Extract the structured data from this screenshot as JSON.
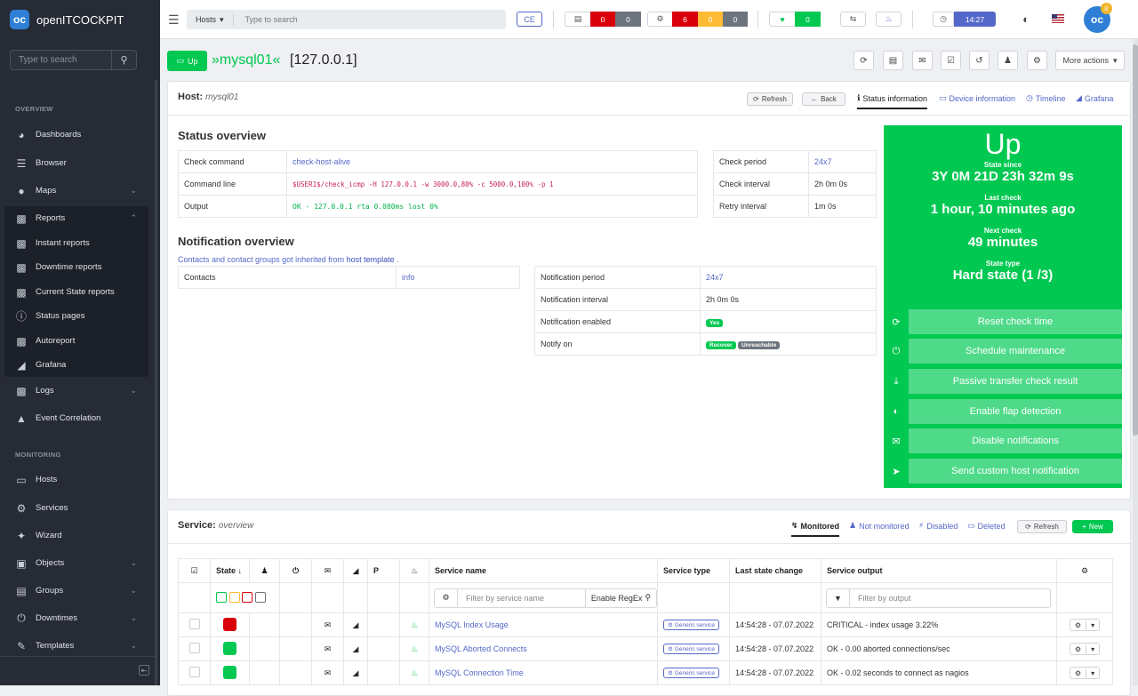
{
  "brand": {
    "name": "openITCOCKPIT",
    "logo_text": "oc"
  },
  "sidebar": {
    "search_placeholder": "Type to search",
    "sections": {
      "overview": "OVERVIEW",
      "monitoring": "MONITORING"
    },
    "items": [
      {
        "label": "Dashboards",
        "icon": "dashboard-icon"
      },
      {
        "label": "Browser",
        "icon": "list-icon"
      },
      {
        "label": "Maps",
        "icon": "map-marker-icon"
      },
      {
        "label": "Reports",
        "icon": "file-icon"
      },
      {
        "label": "Instant reports",
        "icon": "file-icon"
      },
      {
        "label": "Downtime reports",
        "icon": "file-icon"
      },
      {
        "label": "Current State reports",
        "icon": "file-icon"
      },
      {
        "label": "Status pages",
        "icon": "info-icon"
      },
      {
        "label": "Autoreport",
        "icon": "file-icon"
      },
      {
        "label": "Grafana",
        "icon": "chart-area-icon"
      },
      {
        "label": "Logs",
        "icon": "file-icon"
      },
      {
        "label": "Event Correlation",
        "icon": "sitemap-icon"
      },
      {
        "label": "Hosts",
        "icon": "desktop-icon"
      },
      {
        "label": "Services",
        "icon": "cogs-icon"
      },
      {
        "label": "Wizard",
        "icon": "magic-icon"
      },
      {
        "label": "Objects",
        "icon": "cubes-icon"
      },
      {
        "label": "Groups",
        "icon": "object-group-icon"
      },
      {
        "label": "Downtimes",
        "icon": "power-icon"
      },
      {
        "label": "Templates",
        "icon": "edit-icon"
      }
    ]
  },
  "topbar": {
    "search_select": "Hosts",
    "search_placeholder": "Type to search",
    "edition": "CE",
    "hosts_counts": [
      "0",
      "0"
    ],
    "service_counts": [
      "6",
      "0",
      "0"
    ],
    "heart_count": "0",
    "time": "14:27"
  },
  "host": {
    "state_button": "Up",
    "name": "»mysql01«",
    "ip": "[127.0.0.1]",
    "more_actions": "More actions"
  },
  "host_panel": {
    "title": "Host:",
    "subtitle": "mysql01",
    "refresh": "Refresh",
    "back": "Back",
    "tabs": [
      "Status information",
      "Device information",
      "Timeline",
      "Grafana"
    ],
    "status_overview": "Status overview",
    "check_command_label": "Check command",
    "check_command": "check-host-alive",
    "command_line_label": "Command line",
    "command_line": "$USER1$/check_icmp -H 127.0.0.1 -w 3000.0,80% -c 5000.0,100% -p 1",
    "output_label": "Output",
    "output": "OK - 127.0.0.1 rta 0.080ms lost 0%",
    "check_period_label": "Check period",
    "check_period": "24x7",
    "check_interval_label": "Check interval",
    "check_interval": "2h 0m 0s",
    "retry_interval_label": "Retry interval",
    "retry_interval": "1m 0s",
    "notification_overview": "Notification overview",
    "inherit_text": "Contacts and contact groups got inherited from",
    "inherit_link": "host template",
    "contacts_label": "Contacts",
    "contacts": "info",
    "notification_period_label": "Notification period",
    "notification_period": "24x7",
    "notification_interval_label": "Notification interval",
    "notification_interval": "2h 0m 0s",
    "notification_enabled_label": "Notification enabled",
    "notification_enabled": "Yes",
    "notify_on_label": "Notify on",
    "notify_recover": "Recover",
    "notify_unreachable": "Unreachable"
  },
  "state_box": {
    "state": "Up",
    "since_label": "State since",
    "since": "3Y 0M 21D 23h 32m 9s",
    "last_check_label": "Last check",
    "last_check": "1 hour, 10 minutes ago",
    "next_check_label": "Next check",
    "next_check": "49 minutes",
    "state_type_label": "State type",
    "state_type": "Hard state (1 /3)",
    "actions": [
      "Reset check time",
      "Schedule maintenance",
      "Passive transfer check result",
      "Enable flap detection",
      "Disable notifications",
      "Send custom host notification"
    ],
    "color": "#00c851"
  },
  "service_panel": {
    "title": "Service:",
    "subtitle": "overview",
    "tabs": [
      "Monitored",
      "Not monitored",
      "Disabled",
      "Deleted"
    ],
    "refresh": "Refresh",
    "new": "New",
    "headers": {
      "state": "State",
      "name": "Service name",
      "type": "Service type",
      "last_change": "Last state change",
      "output": "Service output",
      "p": "P"
    },
    "filter_name_placeholder": "Filter by service name",
    "enable_regex": "Enable RegEx",
    "filter_output_placeholder": "Filter by output",
    "rows": [
      {
        "name": "MySQL Index Usage",
        "type": "Generic service",
        "last_change": "14:54:28 - 07.07.2022",
        "output": "CRITICAL - index usage 3.22%",
        "state_color": "#d9000b"
      },
      {
        "name": "MySQL Aborted Connects",
        "type": "Generic service",
        "last_change": "14:54:28 - 07.07.2022",
        "output": "OK - 0.00 aborted connections/sec",
        "state_color": "#00c851"
      },
      {
        "name": "MySQL Connection Time",
        "type": "Generic service",
        "last_change": "14:54:28 - 07.07.2022",
        "output": "OK - 0.02 seconds to connect as nagios",
        "state_color": "#00c851"
      }
    ]
  }
}
